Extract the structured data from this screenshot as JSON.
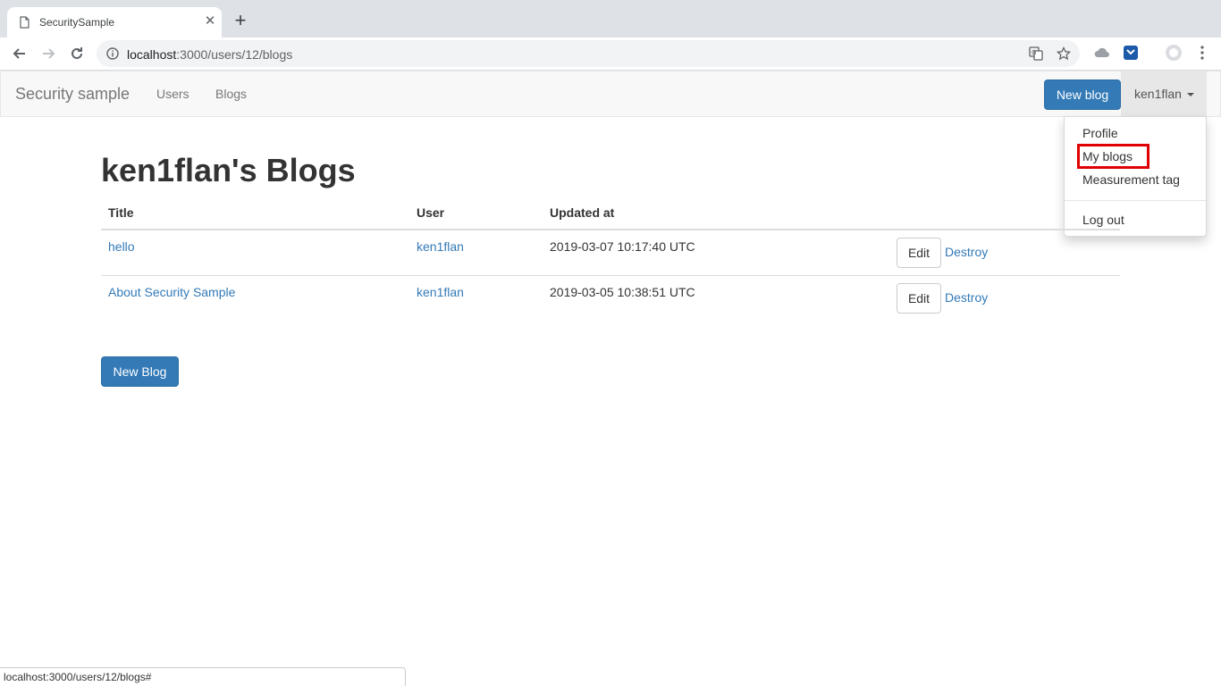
{
  "browser": {
    "tab_title": "SecuritySample",
    "tab_close_glyph": "✕",
    "new_tab_glyph": "+",
    "url_host": "localhost",
    "url_path": ":3000/users/12/blogs",
    "status_url": "localhost:3000/users/12/blogs#"
  },
  "navbar": {
    "brand": "Security sample",
    "links": [
      "Users",
      "Blogs"
    ],
    "new_blog_button": "New blog",
    "user_menu": "ken1flan"
  },
  "user_dropdown": {
    "items": [
      "Profile",
      "My blogs",
      "Measurement tag"
    ],
    "logout": "Log out",
    "highlighted_item": "My blogs",
    "highlight_color": "#e00000"
  },
  "page": {
    "title": "ken1flan's Blogs",
    "new_blog_button": "New Blog"
  },
  "blogs_table": {
    "columns": [
      "Title",
      "User",
      "Updated at"
    ],
    "rows": [
      {
        "title": "hello",
        "user": "ken1flan",
        "updated_at": "2019-03-07 10:17:40 UTC",
        "edit": "Edit",
        "destroy": "Destroy"
      },
      {
        "title": "About Security Sample",
        "user": "ken1flan",
        "updated_at": "2019-03-05 10:38:51 UTC",
        "edit": "Edit",
        "destroy": "Destroy"
      }
    ]
  },
  "colors": {
    "primary": "#337ab7",
    "link": "#337ab7",
    "navbar_bg": "#f8f8f8"
  }
}
